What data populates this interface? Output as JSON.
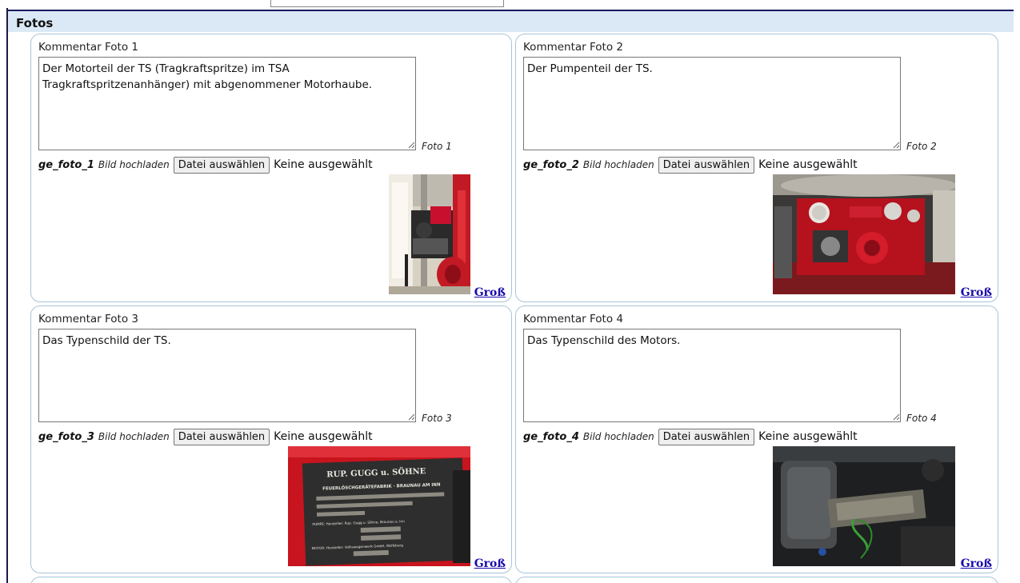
{
  "section": {
    "title": "Fotos"
  },
  "photos": [
    {
      "comment_label": "Kommentar Foto 1",
      "comment_text": "Der Motorteil der TS (Tragkraftspritze) im TSA\nTragkraftspritzenanhänger) mit abgenommener Motorhaube.",
      "foto_tag": "Foto 1",
      "field_name": "ge_foto_1",
      "upload_hint": "Bild hochladen",
      "file_button": "Datei auswählen",
      "file_status": "Keine ausgewählt",
      "enlarge_link": "Groß"
    },
    {
      "comment_label": "Kommentar Foto 2",
      "comment_text": "Der Pumpenteil der TS.",
      "foto_tag": "Foto 2",
      "field_name": "ge_foto_2",
      "upload_hint": "Bild hochladen",
      "file_button": "Datei auswählen",
      "file_status": "Keine ausgewählt",
      "enlarge_link": "Groß"
    },
    {
      "comment_label": "Kommentar Foto 3",
      "comment_text": "Das Typenschild der TS.",
      "foto_tag": "Foto 3",
      "field_name": "ge_foto_3",
      "upload_hint": "Bild hochladen",
      "file_button": "Datei auswählen",
      "file_status": "Keine ausgewählt",
      "enlarge_link": "Groß",
      "plate": {
        "maker": "RUP. GUGG u. SÖHNE",
        "factory": "FEUERLÖSCHGERÄTEFABRIK · BRAUNAU AM INN",
        "pumpe_line": "PUMPE: Hersteller: Rup. Gugg u. Söhne, Braunau a. Inn",
        "motor_line": "MOTOR: Hersteller: Volkswagenwerk GmbH, Wolfsburg"
      }
    },
    {
      "comment_label": "Kommentar Foto 4",
      "comment_text": "Das Typenschild des Motors.",
      "foto_tag": "Foto 4",
      "field_name": "ge_foto_4",
      "upload_hint": "Bild hochladen",
      "file_button": "Datei auswählen",
      "file_status": "Keine ausgewählt",
      "enlarge_link": "Groß"
    }
  ],
  "colors": {
    "header_bg": "#dbe9f6",
    "header_rule": "#1a1a5e",
    "card_border": "#a8c4d8",
    "link": "#1a0dab",
    "engine_red": "#c8102e"
  }
}
